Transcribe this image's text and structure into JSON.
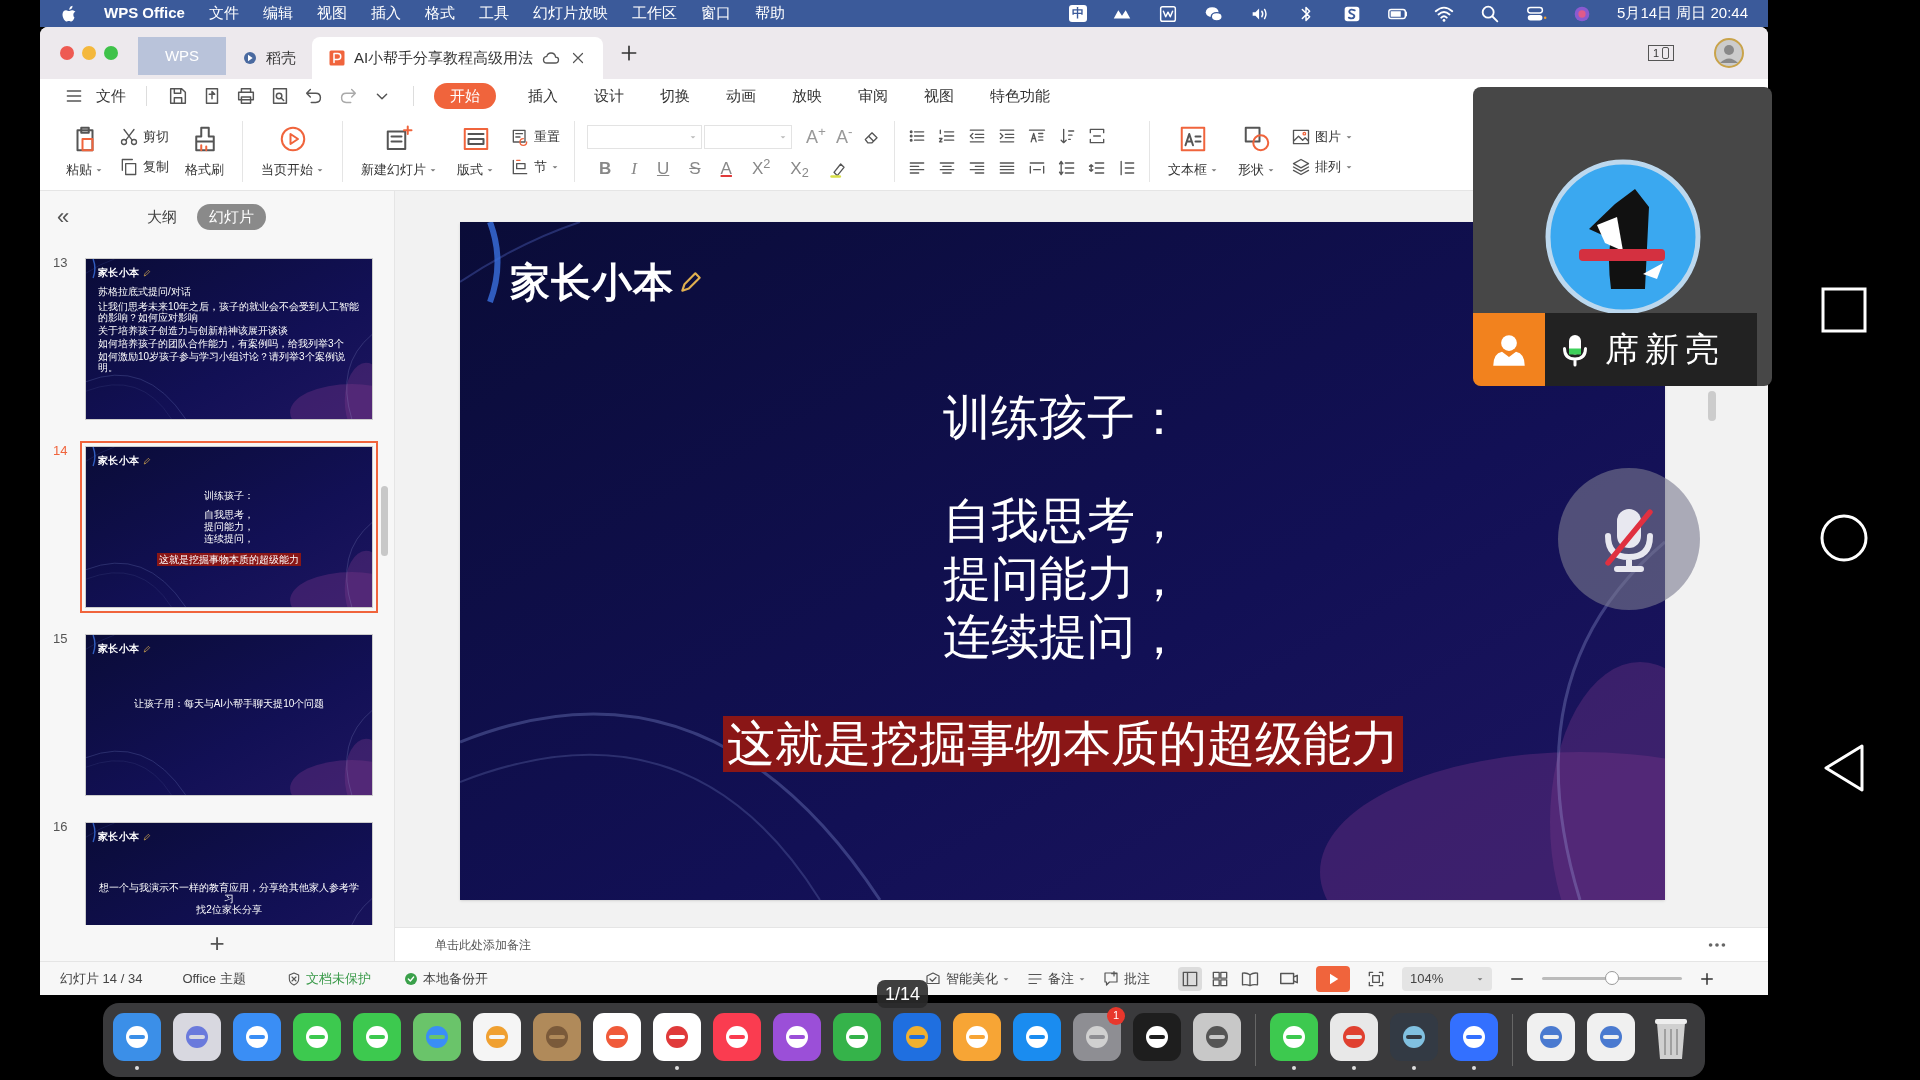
{
  "menu_bar": {
    "app": "WPS Office",
    "items": [
      "文件",
      "编辑",
      "视图",
      "插入",
      "格式",
      "工具",
      "幻灯片放映",
      "工作区",
      "窗口",
      "帮助"
    ],
    "input_method": "中",
    "clock": "5月14日 周日 20:44"
  },
  "window": {
    "tabs": [
      {
        "label": "WPS",
        "kind": "home",
        "selected": false
      },
      {
        "label": "稻壳",
        "kind": "store",
        "selected": false
      },
      {
        "label": "AI小帮手分享教程高级用法",
        "kind": "document",
        "selected": true
      }
    ],
    "device_badge": "1"
  },
  "toolbar": {
    "file_menu": "文件",
    "ribbon_tabs": [
      {
        "label": "开始",
        "selected": true
      },
      {
        "label": "插入",
        "selected": false
      },
      {
        "label": "设计",
        "selected": false
      },
      {
        "label": "切换",
        "selected": false
      },
      {
        "label": "动画",
        "selected": false
      },
      {
        "label": "放映",
        "selected": false
      },
      {
        "label": "审阅",
        "selected": false
      },
      {
        "label": "视图",
        "selected": false
      },
      {
        "label": "特色功能",
        "selected": false
      }
    ]
  },
  "ribbon": [
    {
      "kind": "large",
      "label": "粘贴",
      "dropdown": true
    },
    {
      "kind": "stack",
      "items": [
        {
          "label": "剪切",
          "dropdown": false
        },
        {
          "label": "复制",
          "dropdown": false
        }
      ]
    },
    {
      "kind": "large",
      "label": "格式刷",
      "dropdown": false
    },
    {
      "kind": "separator"
    },
    {
      "kind": "large",
      "label": "当页开始",
      "dropdown": true
    },
    {
      "kind": "separator"
    },
    {
      "kind": "large",
      "label": "新建幻灯片",
      "dropdown": true
    },
    {
      "kind": "large",
      "label": "版式",
      "dropdown": true
    },
    {
      "kind": "stack",
      "items": [
        {
          "label": "重置",
          "dropdown": false
        },
        {
          "label": "节",
          "dropdown": true
        }
      ]
    },
    {
      "kind": "separator"
    },
    {
      "kind": "font",
      "size_buttons": [
        "A$^{+}$",
        "A$^{-}$"
      ],
      "format_buttons": [
        "B",
        "I",
        "U",
        "S",
        "A",
        "X$^{2}$",
        "X$_{2}$"
      ]
    },
    {
      "kind": "separator"
    },
    {
      "kind": "paragraph"
    },
    {
      "kind": "separator"
    },
    {
      "kind": "large",
      "label": "文本框",
      "dropdown": true
    },
    {
      "kind": "large",
      "label": "形状",
      "dropdown": true
    },
    {
      "kind": "stack",
      "items": [
        {
          "label": "图片",
          "dropdown": true
        },
        {
          "label": "排列",
          "dropdown": true
        }
      ]
    }
  ],
  "slides_panel": {
    "collapse": "«",
    "view_tabs": [
      {
        "label": "大纲",
        "selected": false
      },
      {
        "label": "幻灯片",
        "selected": true
      }
    ],
    "add": "+",
    "thumbnails": [
      {
        "number": "13",
        "selected": false,
        "logo": "家长小本",
        "lines": [
          {
            "kind": "heading",
            "text": "苏格拉底式提问/对话"
          },
          {
            "kind": "small",
            "text": "让我们思考未来10年之后，孩子的就业会不会受到人工智能的影响？如何应对影响"
          },
          {
            "kind": "small",
            "text": "关于培养孩子创造力与创新精神该展开谈谈"
          },
          {
            "kind": "small",
            "text": "如何培养孩子的团队合作能力，有案例吗，给我列举3个"
          },
          {
            "kind": "small",
            "text": "如何激励10岁孩子参与学习小组讨论？请列举3个案例说明。"
          }
        ]
      },
      {
        "number": "14",
        "selected": true,
        "logo": "家长小本",
        "lines": [
          {
            "kind": "title",
            "text": "训练孩子："
          },
          {
            "kind": "body",
            "text": "自我思考，"
          },
          {
            "kind": "body",
            "text": "提问能力，"
          },
          {
            "kind": "body",
            "text": "连续提问，"
          },
          {
            "kind": "highlight",
            "text": "这就是挖掘事物本质的超级能力"
          }
        ]
      },
      {
        "number": "15",
        "selected": false,
        "logo": "家长小本",
        "lines": [
          {
            "kind": "title",
            "text": "让孩子用：每天与AI小帮手聊天提10个问题"
          }
        ]
      },
      {
        "number": "16",
        "selected": false,
        "logo": "家长小本",
        "lines": [
          {
            "kind": "bottom",
            "text": "想一个与我演示不一样的教育应用，分享给其他家人参考学习"
          },
          {
            "kind": "bottom",
            "text": "找2位家长分享"
          }
        ]
      }
    ]
  },
  "slide": {
    "logo": "家长小本",
    "lines": [
      {
        "kind": "title",
        "text": "训练孩子："
      },
      {
        "kind": "body",
        "text": "自我思考，"
      },
      {
        "kind": "body",
        "text": "提问能力，"
      },
      {
        "kind": "body",
        "text": "连续提问，"
      },
      {
        "kind": "highlight",
        "text": "这就是挖掘事物本质的超级能力"
      }
    ]
  },
  "notes": {
    "placeholder": "单击此处添加备注"
  },
  "status_bar": {
    "slide_counter": "幻灯片 14 / 34",
    "theme": "Office 主题",
    "protection": "文档未保护",
    "backup": "本地备份开",
    "beautify": "智能美化",
    "notes": "备注",
    "comments": "批注",
    "view_modes": [
      {
        "selected": true
      },
      {
        "selected": false
      },
      {
        "selected": false
      }
    ],
    "zoom": "104%",
    "zoom_slider": {
      "level": 0.5
    }
  },
  "meeting": {
    "name": "席新亮",
    "mic_muted": true
  },
  "dock": {
    "page_indicator": "1/14",
    "badge": "1",
    "apps": [
      {
        "running": true
      },
      {
        "running": false
      },
      {
        "running": false
      },
      {
        "running": false
      },
      {
        "running": false
      },
      {
        "running": false
      },
      {
        "running": false
      },
      {
        "running": false
      },
      {
        "running": false
      },
      {
        "running": true
      },
      {
        "running": false
      },
      {
        "running": false
      },
      {
        "running": false
      },
      {
        "running": false
      },
      {
        "running": false
      },
      {
        "running": false
      },
      {
        "running": false
      },
      {
        "running": false
      },
      {
        "running": false
      },
      {
        "running": true
      },
      {
        "running": true
      },
      {
        "running": true
      },
      {
        "running": true
      },
      {
        "running": false
      },
      {
        "running": false
      },
      {
        "running": false
      }
    ]
  }
}
